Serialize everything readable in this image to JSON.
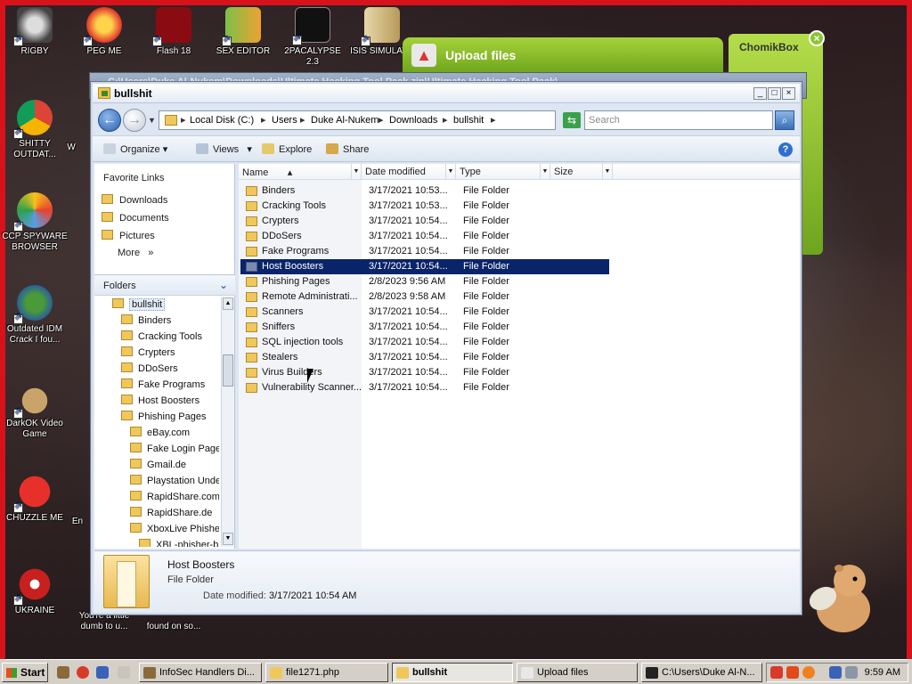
{
  "desktop": {
    "icons": [
      {
        "label": "RIGBY",
        "icon": "raccoon-icon"
      },
      {
        "label": "PEG ME",
        "icon": "peg-icon"
      },
      {
        "label": "Flash 18",
        "icon": "flash-icon"
      },
      {
        "label": "SEX EDITOR",
        "icon": "hxd-icon"
      },
      {
        "label": "2PACALYPSE 2.3",
        "icon": "terminal-icon"
      },
      {
        "label": "ISIS SIMULATO",
        "icon": "book-icon"
      },
      {
        "label": "SHITTY OUTDAT...",
        "icon": "chrome-icon"
      },
      {
        "label": "W",
        "icon": "generic-icon"
      },
      {
        "label": "CCP SPYWARE BROWSER",
        "icon": "browser-icon"
      },
      {
        "label": "Outdated IDM Crack I fou...",
        "icon": "idm-icon"
      },
      {
        "label": "DarkOK Video Game",
        "icon": "money-bag-icon"
      },
      {
        "label": "CHUZZLE ME",
        "icon": "chuzzle-icon"
      },
      {
        "label": "En",
        "icon": "generic-icon"
      },
      {
        "label": "UKRAINE",
        "icon": "radiation-icon"
      },
      {
        "label": "You're a little dumb to u...",
        "icon": "generic-icon"
      },
      {
        "label": "found on so...",
        "icon": "generic-icon"
      }
    ],
    "upload_widget": {
      "label": "Upload files"
    },
    "chomik_widget": {
      "label": "ChomikBox",
      "close": "×"
    }
  },
  "bg_window": {
    "title": "C:\\Users\\Duke Al-Nukem\\Downloads\\Ultimate Hacking Tool Pack.zip\\Ultimate Hacking Tool Pack\\"
  },
  "window": {
    "title": "bullshit",
    "controls": {
      "minimize": "_",
      "maximize": "□",
      "close": "×"
    },
    "address": {
      "crumbs": [
        "Local Disk (C:)",
        "Users",
        "Duke Al-Nukem",
        "Downloads",
        "bullshit"
      ],
      "separator": "▸"
    },
    "search": {
      "placeholder": "Search"
    },
    "toolbar": {
      "organize": "Organize",
      "views": "Views",
      "explore": "Explore",
      "share": "Share",
      "help": "?"
    },
    "nav": {
      "favorites_title": "Favorite Links",
      "favorites": [
        "Downloads",
        "Documents",
        "Pictures"
      ],
      "more": "More",
      "more_chevron": "»",
      "folders_title": "Folders",
      "tree": [
        {
          "label": "bullshit",
          "level": 0,
          "selected": true
        },
        {
          "label": "Binders",
          "level": 1
        },
        {
          "label": "Cracking Tools",
          "level": 1
        },
        {
          "label": "Crypters",
          "level": 1
        },
        {
          "label": "DDoSers",
          "level": 1
        },
        {
          "label": "Fake Programs",
          "level": 1
        },
        {
          "label": "Host Boosters",
          "level": 1
        },
        {
          "label": "Phishing Pages",
          "level": 1
        },
        {
          "label": "eBay.com",
          "level": 2
        },
        {
          "label": "Fake Login Page",
          "level": 2
        },
        {
          "label": "Gmail.de",
          "level": 2
        },
        {
          "label": "Playstation Unde",
          "level": 2
        },
        {
          "label": "RapidShare.com",
          "level": 2
        },
        {
          "label": "RapidShare.de",
          "level": 2
        },
        {
          "label": "XboxLive Phishe",
          "level": 2
        },
        {
          "label": "XBL-phisher-bl",
          "level": 3
        }
      ]
    },
    "columns": {
      "name": "Name",
      "date": "Date modified",
      "type": "Type",
      "size": "Size"
    },
    "files": [
      {
        "name": "Binders",
        "date": "3/17/2021 10:53...",
        "type": "File Folder"
      },
      {
        "name": "Cracking Tools",
        "date": "3/17/2021 10:53...",
        "type": "File Folder"
      },
      {
        "name": "Crypters",
        "date": "3/17/2021 10:54...",
        "type": "File Folder"
      },
      {
        "name": "DDoSers",
        "date": "3/17/2021 10:54...",
        "type": "File Folder"
      },
      {
        "name": "Fake Programs",
        "date": "3/17/2021 10:54...",
        "type": "File Folder"
      },
      {
        "name": "Host Boosters",
        "date": "3/17/2021 10:54...",
        "type": "File Folder",
        "selected": true
      },
      {
        "name": "Phishing Pages",
        "date": "2/8/2023 9:56 AM",
        "type": "File Folder"
      },
      {
        "name": "Remote Administrati...",
        "date": "2/8/2023 9:58 AM",
        "type": "File Folder"
      },
      {
        "name": "Scanners",
        "date": "3/17/2021 10:54...",
        "type": "File Folder"
      },
      {
        "name": "Sniffers",
        "date": "3/17/2021 10:54...",
        "type": "File Folder"
      },
      {
        "name": "SQL injection tools",
        "date": "3/17/2021 10:54...",
        "type": "File Folder"
      },
      {
        "name": "Stealers",
        "date": "3/17/2021 10:54...",
        "type": "File Folder"
      },
      {
        "name": "Virus Builders",
        "date": "3/17/2021 10:54...",
        "type": "File Folder"
      },
      {
        "name": "Vulnerability Scanner...",
        "date": "3/17/2021 10:54...",
        "type": "File Folder"
      }
    ],
    "details": {
      "name": "Host Boosters",
      "type": "File Folder",
      "modified_label": "Date modified:",
      "modified": "3/17/2021 10:54 AM"
    }
  },
  "taskbar": {
    "start": "Start",
    "tasks": [
      {
        "label": "InfoSec Handlers Di...",
        "active": false
      },
      {
        "label": "file1271.php",
        "active": false
      },
      {
        "label": "bullshit",
        "active": true
      },
      {
        "label": "Upload files",
        "active": false
      },
      {
        "label": "C:\\Users\\Duke Al-N...",
        "active": false
      }
    ],
    "clock": "9:59 AM"
  },
  "colors": {
    "border_red": "#d8121a",
    "selection": "#0a246a",
    "widget_green": "#8bc436"
  }
}
